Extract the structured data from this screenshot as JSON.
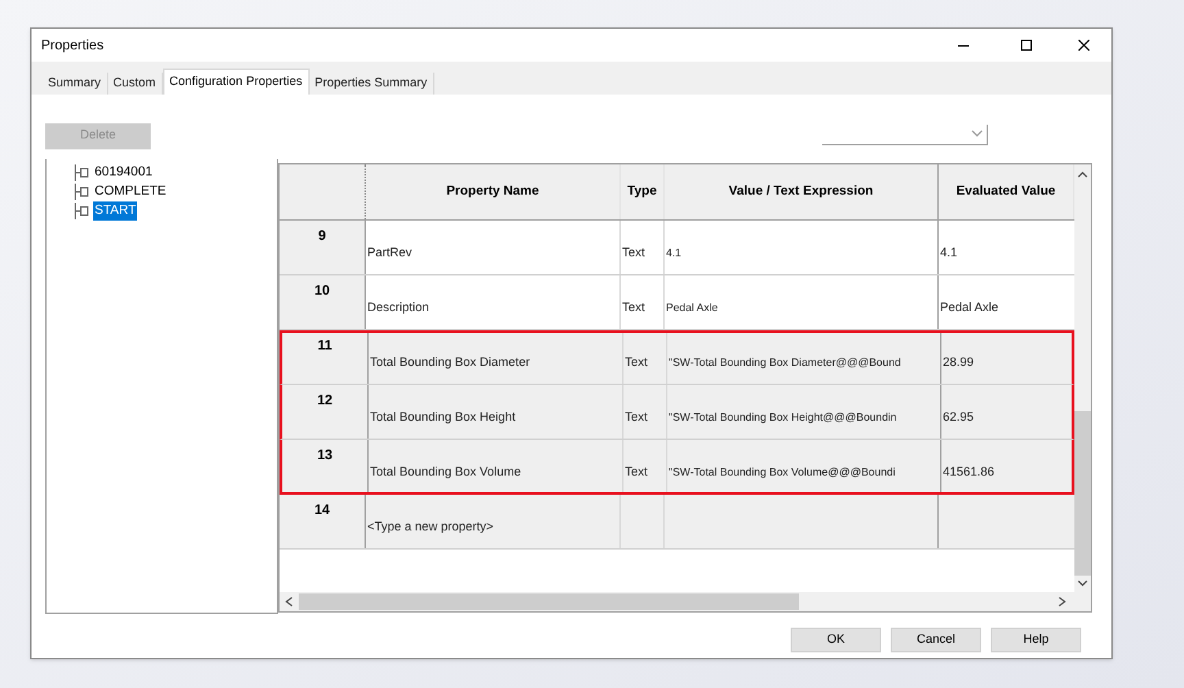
{
  "window": {
    "title": "Properties"
  },
  "tabs": [
    {
      "label": "Summary",
      "selected": false
    },
    {
      "label": "Custom",
      "selected": false
    },
    {
      "label": "Configuration Properties",
      "selected": true
    },
    {
      "label": "Properties Summary",
      "selected": false
    }
  ],
  "delete_button": {
    "label": "Delete",
    "disabled": true
  },
  "tree": [
    {
      "label": "60194001",
      "selected": false
    },
    {
      "label": "COMPLETE",
      "selected": false
    },
    {
      "label": "START",
      "selected": true
    }
  ],
  "table": {
    "columns": [
      "Property Name",
      "Type",
      "Value / Text Expression",
      "Evaluated Value"
    ],
    "rows": [
      {
        "number": "9",
        "name": "PartRev",
        "type": "Text",
        "value": "4.1",
        "evaluated": "4.1",
        "shaded": false,
        "highlighted": false
      },
      {
        "number": "10",
        "name": "Description",
        "type": "Text",
        "value": "Pedal Axle",
        "evaluated": "Pedal Axle",
        "shaded": false,
        "highlighted": false
      },
      {
        "number": "11",
        "name": "Total Bounding Box Diameter",
        "type": "Text",
        "value": "\"SW-Total Bounding Box Diameter@@@Bound",
        "evaluated": "28.99",
        "shaded": true,
        "highlighted": true
      },
      {
        "number": "12",
        "name": "Total Bounding Box Height",
        "type": "Text",
        "value": "\"SW-Total Bounding Box Height@@@Boundin",
        "evaluated": "62.95",
        "shaded": true,
        "highlighted": true
      },
      {
        "number": "13",
        "name": "Total Bounding Box Volume",
        "type": "Text",
        "value": "\"SW-Total Bounding Box Volume@@@Boundi",
        "evaluated": "41561.86",
        "shaded": true,
        "highlighted": true
      },
      {
        "number": "14",
        "name": "<Type a new property>",
        "type": "",
        "value": "",
        "evaluated": "",
        "shaded": true,
        "highlighted": false
      }
    ]
  },
  "buttons": [
    "OK",
    "Cancel",
    "Help"
  ]
}
